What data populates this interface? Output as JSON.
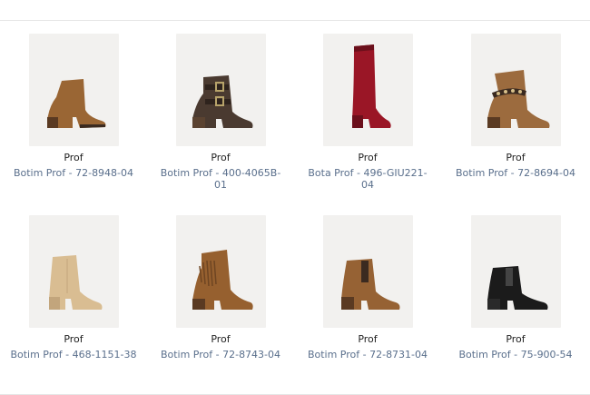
{
  "products": [
    {
      "brand": "Prof",
      "name": "Botim Prof - 72-8948-04",
      "icon": "ankle-boot-brown-icon",
      "color": "#9a6634",
      "secondary": "#5a3a22"
    },
    {
      "brand": "Prof",
      "name": "Botim Prof - 400-4065B-01",
      "icon": "buckle-boot-dark-icon",
      "color": "#4a3a30",
      "secondary": "#9b8a5a"
    },
    {
      "brand": "Prof",
      "name": "Bota Prof - 496-GIU221-04",
      "icon": "tall-boot-red-icon",
      "color": "#9a1626",
      "secondary": "#6b0f1b"
    },
    {
      "brand": "Prof",
      "name": "Botim Prof - 72-8694-04",
      "icon": "studded-boot-tan-icon",
      "color": "#9c6b3e",
      "secondary": "#3a2a20"
    },
    {
      "brand": "Prof",
      "name": "Botim Prof - 468-1151-38",
      "icon": "ankle-boot-beige-icon",
      "color": "#d9bd92",
      "secondary": "#c2a57c"
    },
    {
      "brand": "Prof",
      "name": "Botim Prof - 72-8743-04",
      "icon": "fringe-boot-brown-icon",
      "color": "#96602f",
      "secondary": "#5a3a22"
    },
    {
      "brand": "Prof",
      "name": "Botim Prof - 72-8731-04",
      "icon": "chelsea-boot-brown-icon",
      "color": "#966234",
      "secondary": "#3b2a20"
    },
    {
      "brand": "Prof",
      "name": "Botim Prof - 75-900-54",
      "icon": "chelsea-boot-black-icon",
      "color": "#1b1b1b",
      "secondary": "#444444"
    }
  ]
}
